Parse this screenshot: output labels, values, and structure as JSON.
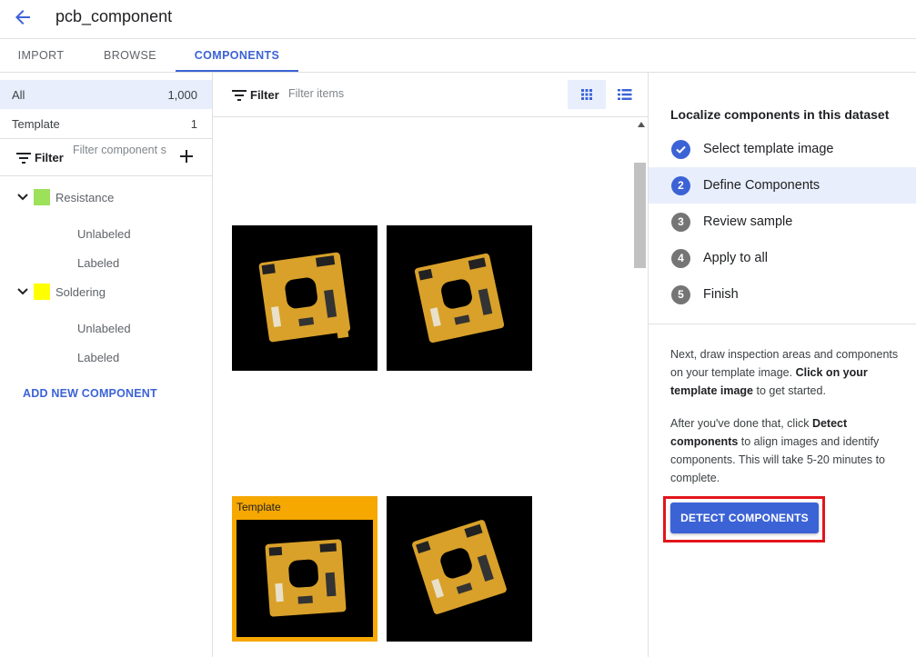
{
  "header": {
    "title": "pcb_component",
    "back_icon": "arrow-left-icon"
  },
  "tabs": [
    {
      "label": "IMPORT",
      "active": false
    },
    {
      "label": "BROWSE",
      "active": false
    },
    {
      "label": "COMPONENTS",
      "active": true
    }
  ],
  "sidebar": {
    "sets": [
      {
        "label": "All",
        "count": "1,000",
        "selected": true
      },
      {
        "label": "Template",
        "count": "1",
        "selected": false
      }
    ],
    "filter": {
      "label": "Filter",
      "placeholder": "Filter component s"
    },
    "components": [
      {
        "name": "Resistance",
        "color": "#9de05a",
        "items": [
          "Unlabeled",
          "Labeled"
        ]
      },
      {
        "name": "Soldering",
        "color": "#ffff00",
        "items": [
          "Unlabeled",
          "Labeled"
        ]
      }
    ],
    "add_component_label": "ADD NEW COMPONENT"
  },
  "gallery": {
    "filter_label": "Filter",
    "filter_placeholder": "Filter items",
    "view_modes": [
      {
        "name": "grid",
        "icon": "grid-view-icon",
        "active": true
      },
      {
        "name": "list",
        "icon": "list-view-icon",
        "active": false
      }
    ],
    "template_tag": "Template"
  },
  "wizard": {
    "heading": "Localize components in this dataset",
    "steps": [
      {
        "number": "1",
        "label": "Select template image",
        "status": "done"
      },
      {
        "number": "2",
        "label": "Define Components",
        "status": "active"
      },
      {
        "number": "3",
        "label": "Review sample",
        "status": "pending"
      },
      {
        "number": "4",
        "label": "Apply to all",
        "status": "pending"
      },
      {
        "number": "5",
        "label": "Finish",
        "status": "pending"
      }
    ],
    "instructions_1": {
      "pre": "Next, draw inspection areas and components on your template image. ",
      "bold": "Click on your template image",
      "post": " to get started."
    },
    "instructions_2": {
      "pre": "After you've done that, click ",
      "bold": "Detect components",
      "post": " to align images and identify components. This will take 5-20 minutes to complete."
    },
    "detect_button_label": "DETECT COMPONENTS"
  },
  "colors": {
    "accent": "#3c63d6",
    "highlight": "#e2151b",
    "template_border": "#f6a700"
  }
}
